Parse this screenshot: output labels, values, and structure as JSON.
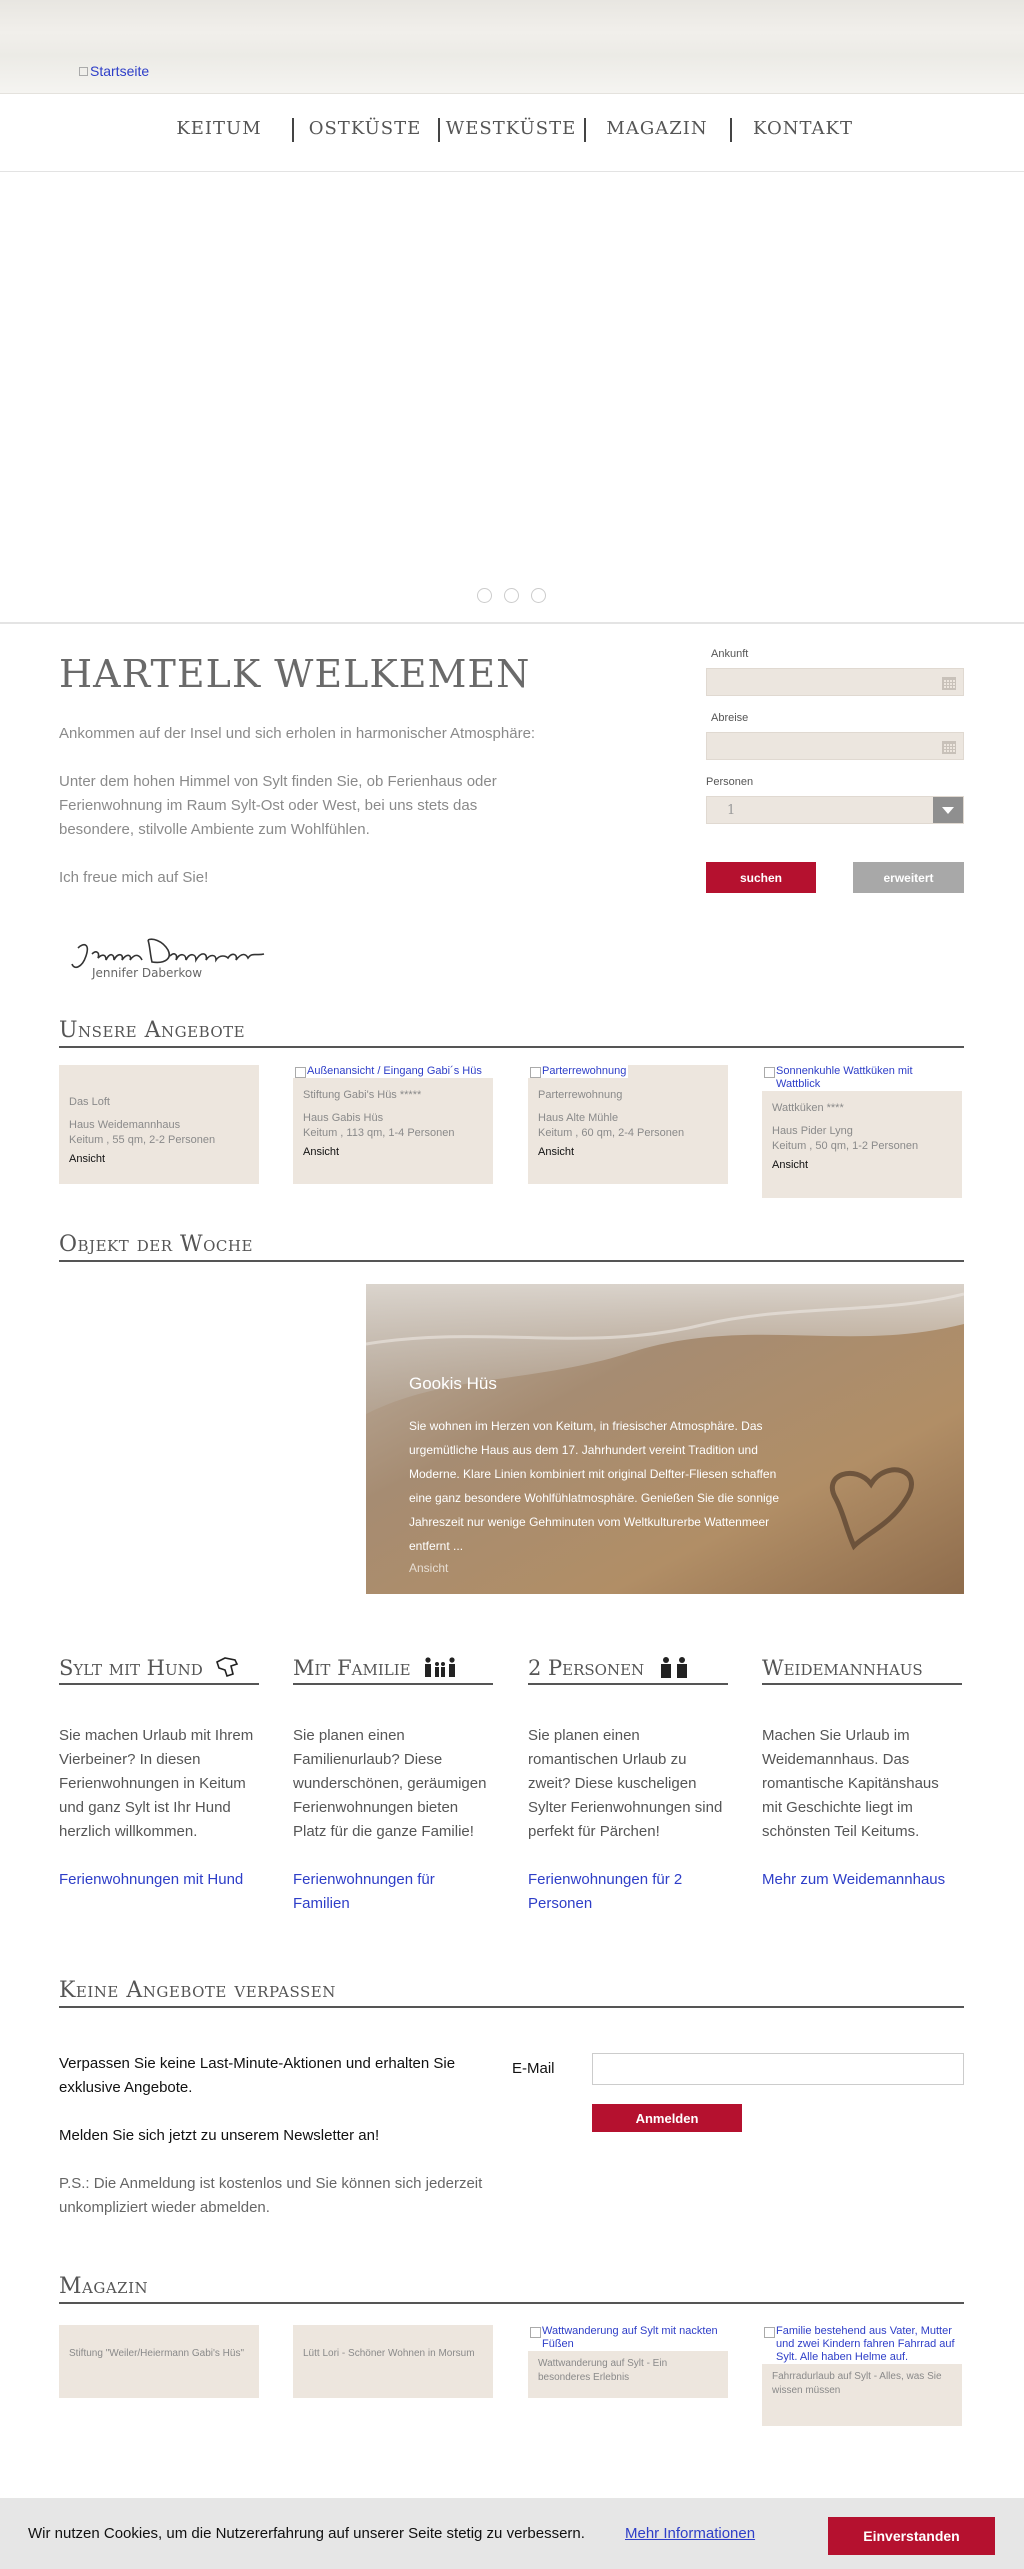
{
  "header": {
    "logo_alt": "Startseite"
  },
  "nav": {
    "items": [
      "KEITUM",
      "OSTKÜSTE",
      "WESTKÜSTE",
      "MAGAZIN",
      "KONTAKT"
    ]
  },
  "intro": {
    "title": "HARTELK WELKEMEN",
    "p1": "Ankommen auf der Insel und sich erholen in harmonischer Atmosphäre:",
    "p2": "Unter dem hohen Himmel von Sylt finden Sie, ob Ferienhaus oder Ferienwohnung im Raum Sylt-Ost oder West, bei uns stets das besondere, stilvolle Ambiente zum Wohlfühlen.",
    "p3": "Ich freue mich auf Sie!",
    "signature": "Jennifer Daberkow"
  },
  "booking": {
    "arrival_label": "Ankunft",
    "departure_label": "Abreise",
    "persons_label": "Personen",
    "persons_value": "1",
    "search_label": "suchen",
    "advanced_label": "erweitert"
  },
  "offers": {
    "heading": "Unsere Angebote",
    "cards": [
      {
        "img_alt": "",
        "name": "Das Loft",
        "house": "Haus Weidemannhaus",
        "details": "Keitum , 55 qm, 2-2 Personen",
        "link": "Ansicht"
      },
      {
        "img_alt": "Außenansicht / Eingang Gabi´s Hüs",
        "name": "Stiftung Gabi's Hüs *****",
        "house": "Haus Gabis Hüs",
        "details": "Keitum , 113 qm, 1-4 Personen",
        "link": "Ansicht"
      },
      {
        "img_alt": "Parterrewohnung",
        "name": "Parterrewohnung",
        "house": "Haus Alte Mühle",
        "details": "Keitum , 60 qm, 2-4 Personen",
        "link": "Ansicht"
      },
      {
        "img_alt": "Sonnenkuhle Wattküken mit Wattblick",
        "name": "Wattküken ****",
        "house": "Haus Pider Lyng",
        "details": "Keitum , 50 qm, 1-2 Personen",
        "link": "Ansicht"
      }
    ]
  },
  "object_of_week": {
    "heading": "Objekt der Woche",
    "title": "Gookis Hüs",
    "text": "Sie wohnen im Herzen von Keitum, in friesischer Atmosphäre. Das urgemütliche Haus aus dem 17. Jahrhundert vereint Tradition und Moderne. Klare Linien kombiniert mit original Delfter-Fliesen schaffen eine ganz besondere Wohlfühlatmosphäre. Genießen Sie die sonnige Jahreszeit nur wenige Gehminuten vom Weltkulturerbe Wattenmeer entfernt ...",
    "link": "Ansicht"
  },
  "features": [
    {
      "heading": "Sylt mit Hund",
      "icon": "dog-icon",
      "text": "Sie machen Urlaub mit Ihrem Vierbeiner? In diesen Ferienwohnungen in Keitum und ganz Sylt ist Ihr Hund herzlich willkommen.",
      "link": "Ferienwohnungen mit Hund"
    },
    {
      "heading": "Mit Familie",
      "icon": "family-icon",
      "text": "Sie planen einen Familienurlaub? Diese wunderschönen, geräumigen Ferienwohnungen bieten Platz für die ganze Familie!",
      "link": "Ferienwohnungen für Familien"
    },
    {
      "heading": "2 Personen",
      "icon": "couple-icon",
      "text": "Sie planen einen romantischen Urlaub zu zweit? Diese kuscheligen Sylter Ferienwohnungen sind perfekt für Pärchen!",
      "link": "Ferienwohnungen für 2 Personen"
    },
    {
      "heading": "Weidemannhaus",
      "icon": "",
      "text": "Machen Sie Urlaub im Weidemannhaus. Das romantische Kapitänshaus mit Geschichte liegt im schönsten Teil Keitums.",
      "link": "Mehr zum Weidemannhaus"
    }
  ],
  "newsletter": {
    "heading": "Keine Angebote verpassen",
    "p1": "Verpassen Sie keine Last-Minute-Aktionen und erhalten Sie exklusive Angebote.",
    "p2": "Melden Sie sich jetzt zu unserem Newsletter an!",
    "p3": "P.S.: Die Anmeldung ist kostenlos und Sie können sich jederzeit unkompliziert wieder abmelden.",
    "email_label": "E-Mail",
    "submit_label": "Anmelden"
  },
  "magazine": {
    "heading": "Magazin",
    "cards": [
      {
        "img_alt": "",
        "title": "Stiftung \"Weiler/Heiermann Gabi's Hüs\""
      },
      {
        "img_alt": "",
        "title": "Lütt Lori - Schöner Wohnen in Morsum"
      },
      {
        "img_alt": "Wattwanderung auf Sylt mit nackten Füßen",
        "title": "Wattwanderung auf Sylt - Ein besonderes Erlebnis"
      },
      {
        "img_alt": "Familie bestehend aus Vater, Mutter und zwei Kindern fahren Fahrrad auf Sylt. Alle haben Helme auf.",
        "title": "Fahrradurlaub auf Sylt - Alles, was Sie wissen müssen"
      }
    ]
  },
  "cookie": {
    "text": "Wir nutzen Cookies, um die Nutzererfahrung auf unserer Seite stetig zu verbessern.",
    "more": "Mehr Informationen",
    "accept": "Einverstanden"
  },
  "colors": {
    "accent_red": "#b5112f",
    "card_beige": "#ede6de",
    "link_blue": "#2e3ec8"
  }
}
